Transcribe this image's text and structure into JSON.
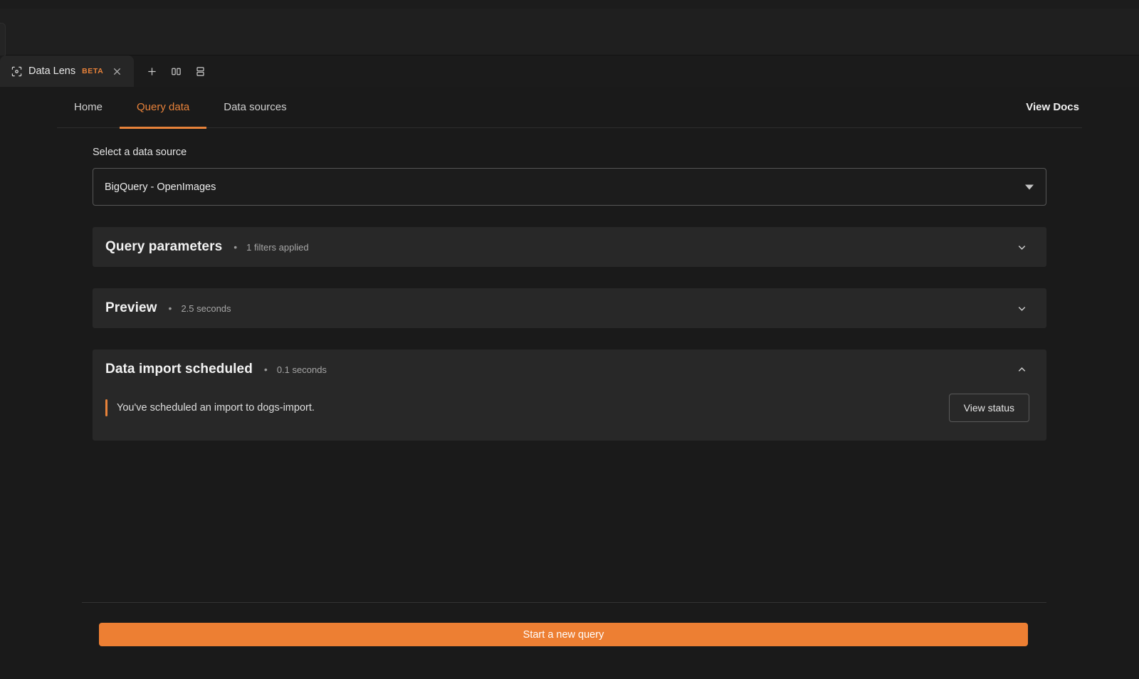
{
  "window": {
    "tab": {
      "icon": "scan-focus-icon",
      "title": "Data Lens",
      "badge": "BETA",
      "close_icon": "close-icon"
    },
    "actions": [
      {
        "name": "new-tab-button",
        "icon": "plus-icon"
      },
      {
        "name": "split-vertical-button",
        "icon": "split-vertical-icon"
      },
      {
        "name": "split-horizontal-button",
        "icon": "split-horizontal-icon"
      }
    ]
  },
  "nav": {
    "tabs": [
      {
        "label": "Home",
        "active": false
      },
      {
        "label": "Query data",
        "active": true
      },
      {
        "label": "Data sources",
        "active": false
      }
    ],
    "view_docs_label": "View Docs"
  },
  "datasource": {
    "label": "Select a data source",
    "selected": "BigQuery - OpenImages",
    "caret_icon": "caret-down-icon"
  },
  "panels": [
    {
      "title": "Query parameters",
      "separator": "•",
      "meta": "1 filters applied",
      "expanded": false,
      "chevron_icon": "chevron-down-icon"
    },
    {
      "title": "Preview",
      "separator": "•",
      "meta": "2.5 seconds",
      "expanded": false,
      "chevron_icon": "chevron-down-icon"
    },
    {
      "title": "Data import scheduled",
      "separator": "•",
      "meta": "0.1 seconds",
      "expanded": true,
      "chevron_icon": "chevron-up-icon",
      "alert_text": "You've scheduled an import to dogs-import.",
      "action_label": "View status"
    }
  ],
  "footer": {
    "primary_label": "Start a new query"
  },
  "colors": {
    "accent": "#e8823a",
    "primary_button": "#ed7f33",
    "page_bg": "#1a1a1a",
    "panel_bg": "#282828"
  }
}
